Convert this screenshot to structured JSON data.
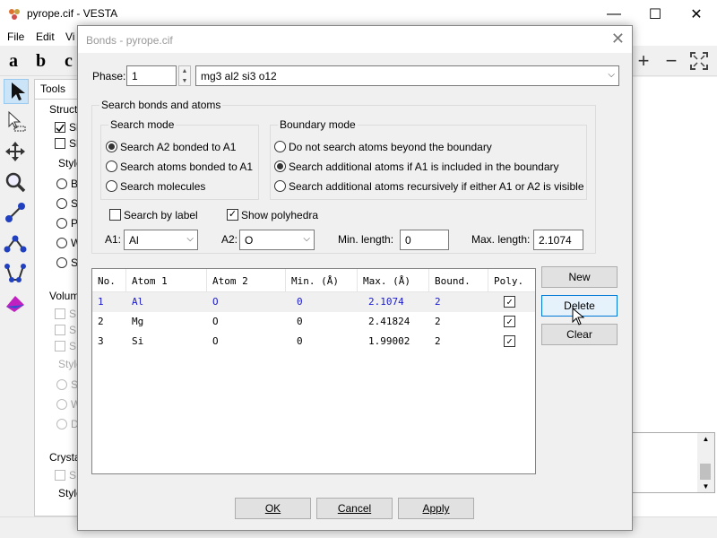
{
  "main_window": {
    "title": "pyrope.cif - VESTA",
    "menus": [
      "File",
      "Edit",
      "Vi"
    ],
    "toolbar_letters": [
      "a",
      "b",
      "c"
    ],
    "tools_tab": "Tools",
    "panel_labels": {
      "struct": "Struct",
      "style": "Style",
      "volume": "Volum",
      "crystal": "Crysta"
    },
    "panel_items": {
      "s_a": "Sh",
      "s_b": "Sh",
      "b": "B",
      "sp": "Sp",
      "p": "P",
      "w": "W",
      "st": "St",
      "v1": "SI",
      "v2": "SI",
      "v3": "Sı",
      "v_style": "Style",
      "v_s": "Sı",
      "v_w": "W",
      "v_d": "D",
      "c1": "SI",
      "c_style": "Style"
    }
  },
  "dialog": {
    "title": "Bonds - pyrope.cif",
    "close_glyph": "✕",
    "phase_label": "Phase:",
    "phase_value": "1",
    "phase_name": "mg3 al2 si3 o12",
    "search_group_title": "Search bonds and atoms",
    "search_mode": {
      "title": "Search mode",
      "options": [
        "Search A2 bonded to A1",
        "Search atoms bonded to A1",
        "Search molecules"
      ],
      "selected": 0
    },
    "boundary_mode": {
      "title": "Boundary mode",
      "options": [
        "Do not search atoms beyond the boundary",
        "Search additional atoms if A1 is included in the boundary",
        "Search additional atoms recursively if either A1 or A2 is visible"
      ],
      "selected": 1
    },
    "search_by_label": {
      "label": "Search by label",
      "checked": false
    },
    "show_polyhedra": {
      "label": "Show polyhedra",
      "checked": true
    },
    "a1_label": "A1:",
    "a1_value": "Al",
    "a2_label": "A2:",
    "a2_value": "O",
    "min_length_label": "Min. length:",
    "min_length_value": "0",
    "max_length_label": "Max. length:",
    "max_length_value": "2.1074",
    "table": {
      "columns": [
        "No.",
        "Atom 1",
        "Atom 2",
        "Min. (Å)",
        "Max. (Å)",
        "Bound.",
        "Poly."
      ],
      "rows": [
        {
          "no": "1",
          "atom1": "Al",
          "atom2": "O",
          "min": "0",
          "max": "2.1074",
          "bound": "2",
          "poly": true,
          "selected": true
        },
        {
          "no": "2",
          "atom1": "Mg",
          "atom2": "O",
          "min": "0",
          "max": "2.41824",
          "bound": "2",
          "poly": true,
          "selected": false
        },
        {
          "no": "3",
          "atom1": "Si",
          "atom2": "O",
          "min": "0",
          "max": "1.99002",
          "bound": "2",
          "poly": true,
          "selected": false
        }
      ]
    },
    "buttons": {
      "new": "New",
      "delete": "Delete",
      "clear": "Clear",
      "ok": "OK",
      "cancel": "Cancel",
      "apply": "Apply"
    },
    "check_glyph": "✓"
  }
}
